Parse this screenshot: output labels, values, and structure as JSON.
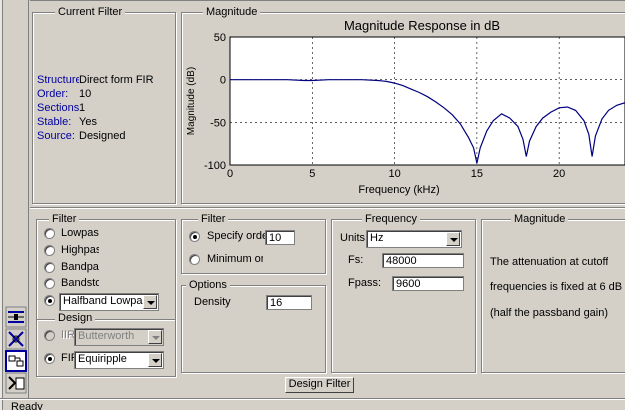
{
  "current_filter": {
    "title": "Current Filter",
    "rows": [
      {
        "label": "Structure:",
        "value": "Direct form FIR"
      },
      {
        "label": "Order:",
        "value": "10"
      },
      {
        "label": "Sections:",
        "value": "1"
      },
      {
        "label": "Stable:",
        "value": "Yes"
      },
      {
        "label": "Source:",
        "value": "Designed"
      }
    ]
  },
  "magnitude_panel": {
    "title": "Magnitude"
  },
  "chart_data": {
    "type": "line",
    "title": "Magnitude Response in dB",
    "xlabel": "Frequency (kHz)",
    "ylabel": "Magnitude (dB)",
    "xlim": [
      0,
      24
    ],
    "ylim": [
      -100,
      50
    ],
    "xticks": [
      0,
      5,
      10,
      15,
      20
    ],
    "yticks": [
      50,
      0,
      -50,
      -100
    ],
    "grid": true,
    "line_color": "#00007f",
    "series": [
      {
        "x": [
          0,
          2,
          3.5,
          4.5,
          5,
          6,
          7,
          8,
          9,
          9.5,
          10,
          10.5,
          11,
          11.5,
          12,
          12.5,
          13,
          13.5,
          14,
          14.5,
          14.8,
          15,
          15.2,
          15.6,
          16,
          16.5,
          17,
          17.5,
          17.8,
          18,
          18.2,
          18.6,
          19,
          19.5,
          20,
          20.5,
          21,
          21.5,
          21.8,
          22,
          22.2,
          22.6,
          23,
          23.5,
          24
        ],
        "y": [
          0,
          0,
          0,
          -1,
          -1,
          0,
          0,
          0,
          -1,
          -2,
          -4,
          -7,
          -11,
          -15,
          -20,
          -26,
          -33,
          -41,
          -52,
          -68,
          -80,
          -98,
          -80,
          -60,
          -48,
          -40,
          -45,
          -55,
          -70,
          -90,
          -72,
          -55,
          -45,
          -38,
          -33,
          -32,
          -36,
          -48,
          -64,
          -90,
          -66,
          -46,
          -36,
          -30,
          -27
        ]
      }
    ]
  },
  "filter_type": {
    "title": "Filter",
    "options": [
      "Lowpass",
      "Highpass",
      "Bandpass",
      "Bandstop"
    ],
    "selected_label": "Halfband Lowpass"
  },
  "design_method": {
    "title": "Design",
    "iir_label": "IIR",
    "iir_value": "Butterworth",
    "fir_label": "FIR",
    "fir_value": "Equiripple"
  },
  "filter_order": {
    "title": "Filter",
    "specify_label": "Specify order:",
    "specify_value": "10",
    "minimum_label": "Minimum order"
  },
  "options": {
    "title": "Options",
    "density_label": "Density",
    "density_value": "16"
  },
  "frequency": {
    "title": "Frequency",
    "units_label": "Units:",
    "units_value": "Hz",
    "fs_label": "Fs:",
    "fs_value": "48000",
    "fpass_label": "Fpass:",
    "fpass_value": "9600"
  },
  "magnitude_spec": {
    "title": "Magnitude",
    "line1": "The attenuation at cutoff",
    "line2": "frequencies is fixed at 6 dB",
    "line3": "(half the passband gain)"
  },
  "design_button": "Design Filter",
  "status": "Ready"
}
